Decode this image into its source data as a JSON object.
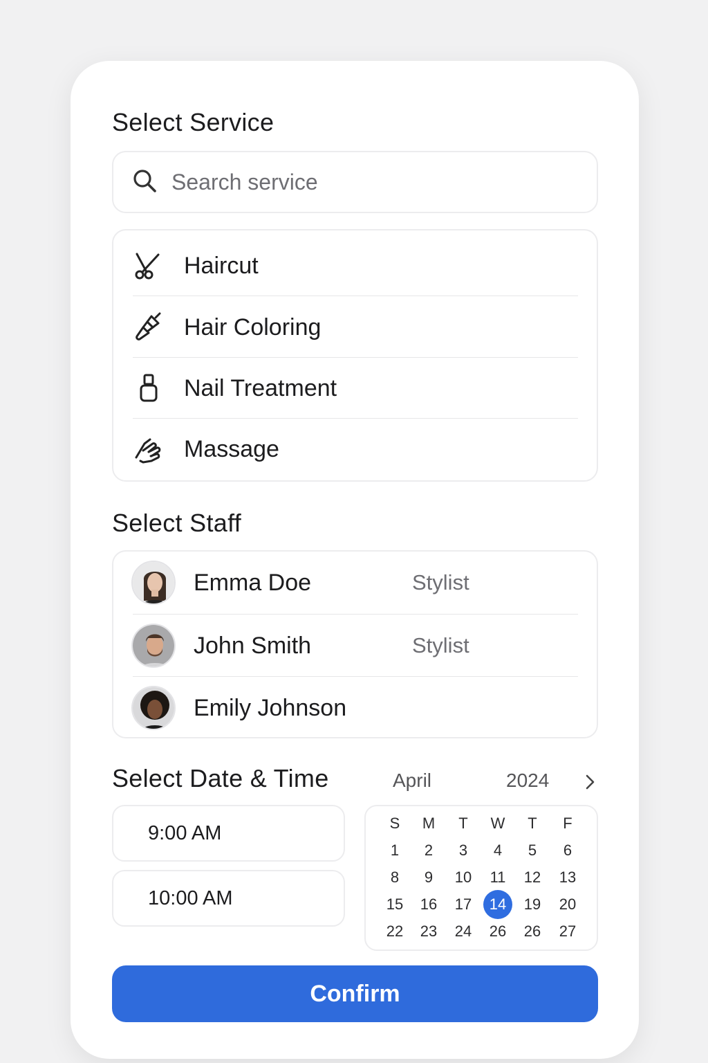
{
  "service": {
    "title": "Select Service",
    "search_placeholder": "Search service",
    "items": [
      {
        "label": "Haircut",
        "icon": "scissors-icon"
      },
      {
        "label": "Hair Coloring",
        "icon": "brush-icon"
      },
      {
        "label": "Nail Treatment",
        "icon": "nail-polish-icon"
      },
      {
        "label": "Massage",
        "icon": "hand-icon"
      }
    ]
  },
  "staff": {
    "title": "Select Staff",
    "members": [
      {
        "name": "Emma Doe",
        "role": "Stylist"
      },
      {
        "name": "John Smith",
        "role": "Stylist"
      },
      {
        "name": "Emily Johnson",
        "role": ""
      }
    ]
  },
  "datetime": {
    "title": "Select Date & Time",
    "times": [
      "9:00 AM",
      "10:00 AM"
    ],
    "calendar": {
      "month": "April",
      "year": "2024",
      "weekdays": [
        "S",
        "M",
        "T",
        "W",
        "T",
        "F"
      ],
      "weeks": [
        [
          "1",
          "2",
          "3",
          "4",
          "5",
          "6"
        ],
        [
          "8",
          "9",
          "10",
          "11",
          "12",
          "13"
        ],
        [
          "15",
          "16",
          "17",
          "14",
          "19",
          "20"
        ],
        [
          "22",
          "23",
          "24",
          "26",
          "26",
          "27"
        ]
      ],
      "selected": "14"
    }
  },
  "confirm_label": "Confirm",
  "colors": {
    "accent": "#2f6bdc",
    "text": "#1c1c1e",
    "muted": "#6e6e73",
    "border": "#ececee"
  }
}
